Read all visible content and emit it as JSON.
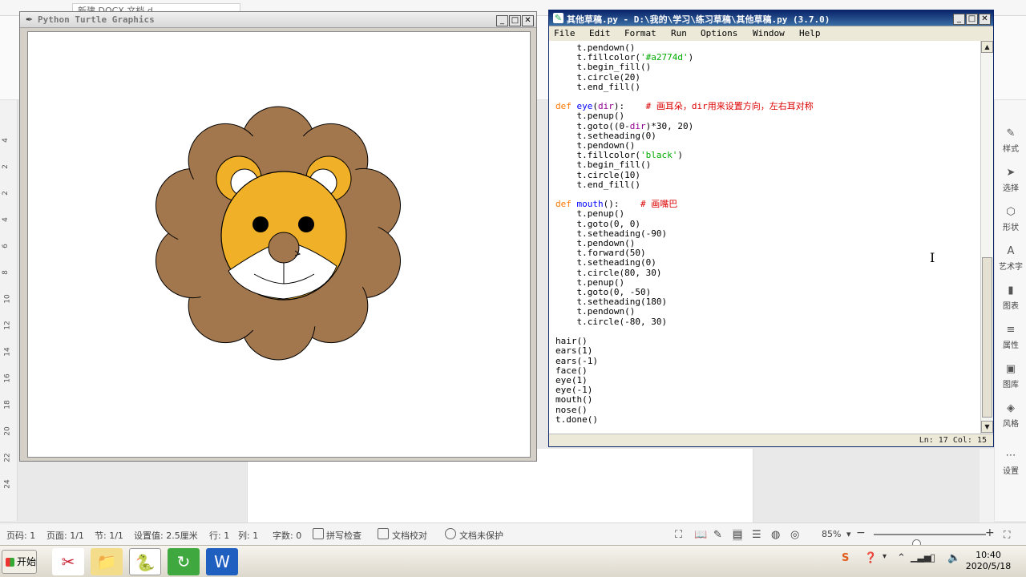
{
  "wps": {
    "tab_title": "新建 DOCX 文档.d",
    "ruler_numbers": [
      "4",
      "2",
      "2",
      "4",
      "6",
      "8",
      "10",
      "12",
      "14",
      "16",
      "18",
      "20",
      "22",
      "24"
    ],
    "right_panel": [
      {
        "label": "样式",
        "icon": "✎"
      },
      {
        "label": "选择",
        "icon": "➤"
      },
      {
        "label": "形状",
        "icon": "⬡"
      },
      {
        "label": "艺术字",
        "icon": "A"
      },
      {
        "label": "图表",
        "icon": "▮"
      },
      {
        "label": "属性",
        "icon": "≡"
      },
      {
        "label": "图库",
        "icon": "▣"
      },
      {
        "label": "风格",
        "icon": "◈"
      },
      {
        "label": "设置",
        "icon": "⋯"
      }
    ],
    "status": {
      "page_code": "页码: 1",
      "page": "页面: 1/1",
      "section": "节: 1/1",
      "setting": "设置值: 2.5厘米",
      "row": "行: 1",
      "col": "列: 1",
      "words": "字数: 0",
      "spellcheck": "拼写检查",
      "proofread": "文档校对",
      "unprotected": "文档未保护",
      "zoom": "85%",
      "zoom_level": 0.38
    }
  },
  "turtle_window": {
    "title": "Python Turtle Graphics",
    "colors": {
      "mane": "#a2774d",
      "face": "#f0b027",
      "mouth": "#ffffff",
      "eye": "#000000",
      "nose": "#a2774d"
    }
  },
  "idle_window": {
    "title": "其他草稿.py - D:\\我的\\学习\\练习草稿\\其他草稿.py (3.7.0)",
    "menu": [
      "File",
      "Edit",
      "Format",
      "Run",
      "Options",
      "Window",
      "Help"
    ],
    "code_lines": [
      "    t.pendown()",
      "    t.fillcolor('#a2774d')",
      "    t.begin_fill()",
      "    t.circle(20)",
      "    t.end_fill()",
      "",
      "def eye(dir):    # 画耳朵，dir用来设置方向，左右耳对称",
      "    t.penup()",
      "    t.goto((0-dir)*30, 20)",
      "    t.setheading(0)",
      "    t.pendown()",
      "    t.fillcolor('black')",
      "    t.begin_fill()",
      "    t.circle(10)",
      "    t.end_fill()",
      "",
      "def mouth():    # 画嘴巴",
      "    t.penup()",
      "    t.goto(0, 0)",
      "    t.setheading(-90)",
      "    t.pendown()",
      "    t.forward(50)",
      "    t.setheading(0)",
      "    t.circle(80, 30)",
      "    t.penup()",
      "    t.goto(0, -50)",
      "    t.setheading(180)",
      "    t.pendown()",
      "    t.circle(-80, 30)",
      "",
      "hair()",
      "ears(1)",
      "ears(-1)",
      "face()",
      "eye(1)",
      "eye(-1)",
      "mouth()",
      "nose()",
      "t.done()"
    ],
    "status": "Ln: 17  Col: 15"
  },
  "taskbar": {
    "start_label": "开始",
    "apps": [
      {
        "name": "snipping-tool",
        "icon": "✂"
      },
      {
        "name": "file-explorer",
        "icon": "📁"
      },
      {
        "name": "python",
        "icon": "🐍"
      },
      {
        "name": "browser",
        "icon": "↻"
      },
      {
        "name": "wps-writer",
        "icon": "W"
      }
    ],
    "clock_time": "10:40",
    "clock_date": "2020/5/18"
  }
}
